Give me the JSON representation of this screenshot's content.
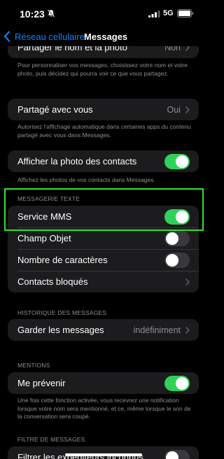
{
  "status_bar": {
    "time": "10:23",
    "network": "5G"
  },
  "nav": {
    "back_label": "Réseau cellulaire",
    "title": "Messages"
  },
  "partial_row": {
    "label": "Partager le nom et la photo",
    "value": "Non"
  },
  "share_name_footnote": "Pour personnaliser vos messages, choisissez votre nom et votre photo, puis décidez qui pourra voir ce que vous partagez.",
  "shared_with_you": {
    "label": "Partagé avec vous",
    "value": "Oui"
  },
  "shared_footnote": "Autorisez l'affichage automatique dans certaines apps du contenu partagé avec vous dans Messages.",
  "contact_photos": {
    "label": "Afficher la photo des contacts",
    "on": true
  },
  "contact_photos_footnote": "Affichez les photos de vos contacts dans Messages.",
  "text_messaging": {
    "header": "MESSAGERIE TEXTE",
    "mms": {
      "label": "Service MMS",
      "on": true
    },
    "subject": {
      "label": "Champ Objet",
      "on": false
    },
    "char_count": {
      "label": "Nombre de caractères",
      "on": false
    },
    "blocked": {
      "label": "Contacts bloqués"
    }
  },
  "history": {
    "header": "HISTORIQUE DES MESSAGES",
    "keep": {
      "label": "Garder les messages",
      "value": "indéfiniment"
    }
  },
  "mentions": {
    "header": "MENTIONS",
    "notify": {
      "label": "Me prévenir",
      "on": true
    },
    "footnote": "Une fois cette fonction activée, vous recevrez une notification lorsque votre nom sera mentionné, et ce, même lorsque le son de la conversation sera coupé."
  },
  "filtering": {
    "header": "FILTRE DE MESSAGES",
    "unknown": {
      "label": "Filtrer les expéditeurs inconnus",
      "on": false
    }
  },
  "colors": {
    "accent": "#0a84ff",
    "toggle_on": "#30d158",
    "highlight": "#2ee32e"
  }
}
